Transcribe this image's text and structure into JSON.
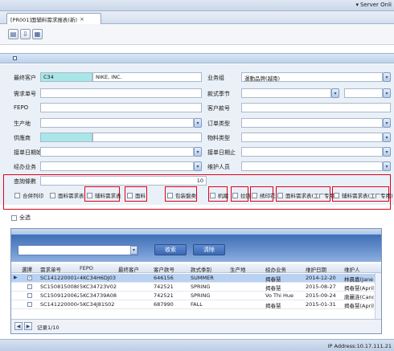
{
  "window": {
    "server_status": "Server Onli"
  },
  "tab": {
    "title": "[PR001]面辅料需求报表(新)",
    "close": "×"
  },
  "form": {
    "customer_label": "最终客户",
    "customer_code": "C34",
    "customer_name": "NIKE, INC.",
    "business_group_label": "业务组",
    "business_group_value": "運動品牌(越南)",
    "demand_no_label": "需求单号",
    "season_label": "款式季节",
    "fepo_label": "FEPO",
    "customer_style_label": "客户款号",
    "production_label": "生产地",
    "order_type_label": "订单类型",
    "supplier_label": "供應商",
    "material_type_label": "物料类型",
    "order_date_start_label": "接单日期始",
    "order_date_end_label": "接单日期止",
    "handler_label": "经办业务",
    "maintainer_label": "维护人员",
    "query_count_label": "查詢條數",
    "query_count_value": "10"
  },
  "options": [
    "合併列印",
    "面料需求表",
    "辅料需求表",
    "面料",
    "包装盤类",
    "机織",
    "拉链",
    "绣印花",
    "面料需求表(工厂专用)",
    "辅料需求表(工厂专用)"
  ],
  "select_all_label": "全选",
  "search": {
    "button": "收索",
    "clear": "清除"
  },
  "table": {
    "headers": [
      "選擇",
      "需求单号",
      "FEPO",
      "最终客户",
      "客户款号",
      "款式季别",
      "生产地",
      "经办业务",
      "维护日期",
      "维护人"
    ],
    "rows": [
      [
        "SC1412200014",
        "4KC34H6DJ03",
        "",
        "646156",
        "SUMMER",
        "",
        "揭春慧",
        "2014-12-20",
        "林晨嘉(Jane LIn)"
      ],
      [
        "SC1508150088",
        "5KC34723V02",
        "",
        "742521",
        "SPRING",
        "",
        "揭春慧",
        "2015-08-27",
        "揭春慧(April Chie..."
      ],
      [
        "SC1509120062",
        "5KC34739A08",
        "",
        "742521",
        "SPRING",
        "",
        "Vo Thi Hue",
        "2015-09-24",
        "唐麗涟(Candy Ta..."
      ],
      [
        "SC1412200004",
        "5KC34J81S02",
        "",
        "687990",
        "FALL",
        "",
        "揭春慧",
        "2015-01-31",
        "揭春慧(April Chie..."
      ]
    ],
    "pager": "记录1/10"
  },
  "status": {
    "ip": "IP Address:10.17.111.21"
  }
}
